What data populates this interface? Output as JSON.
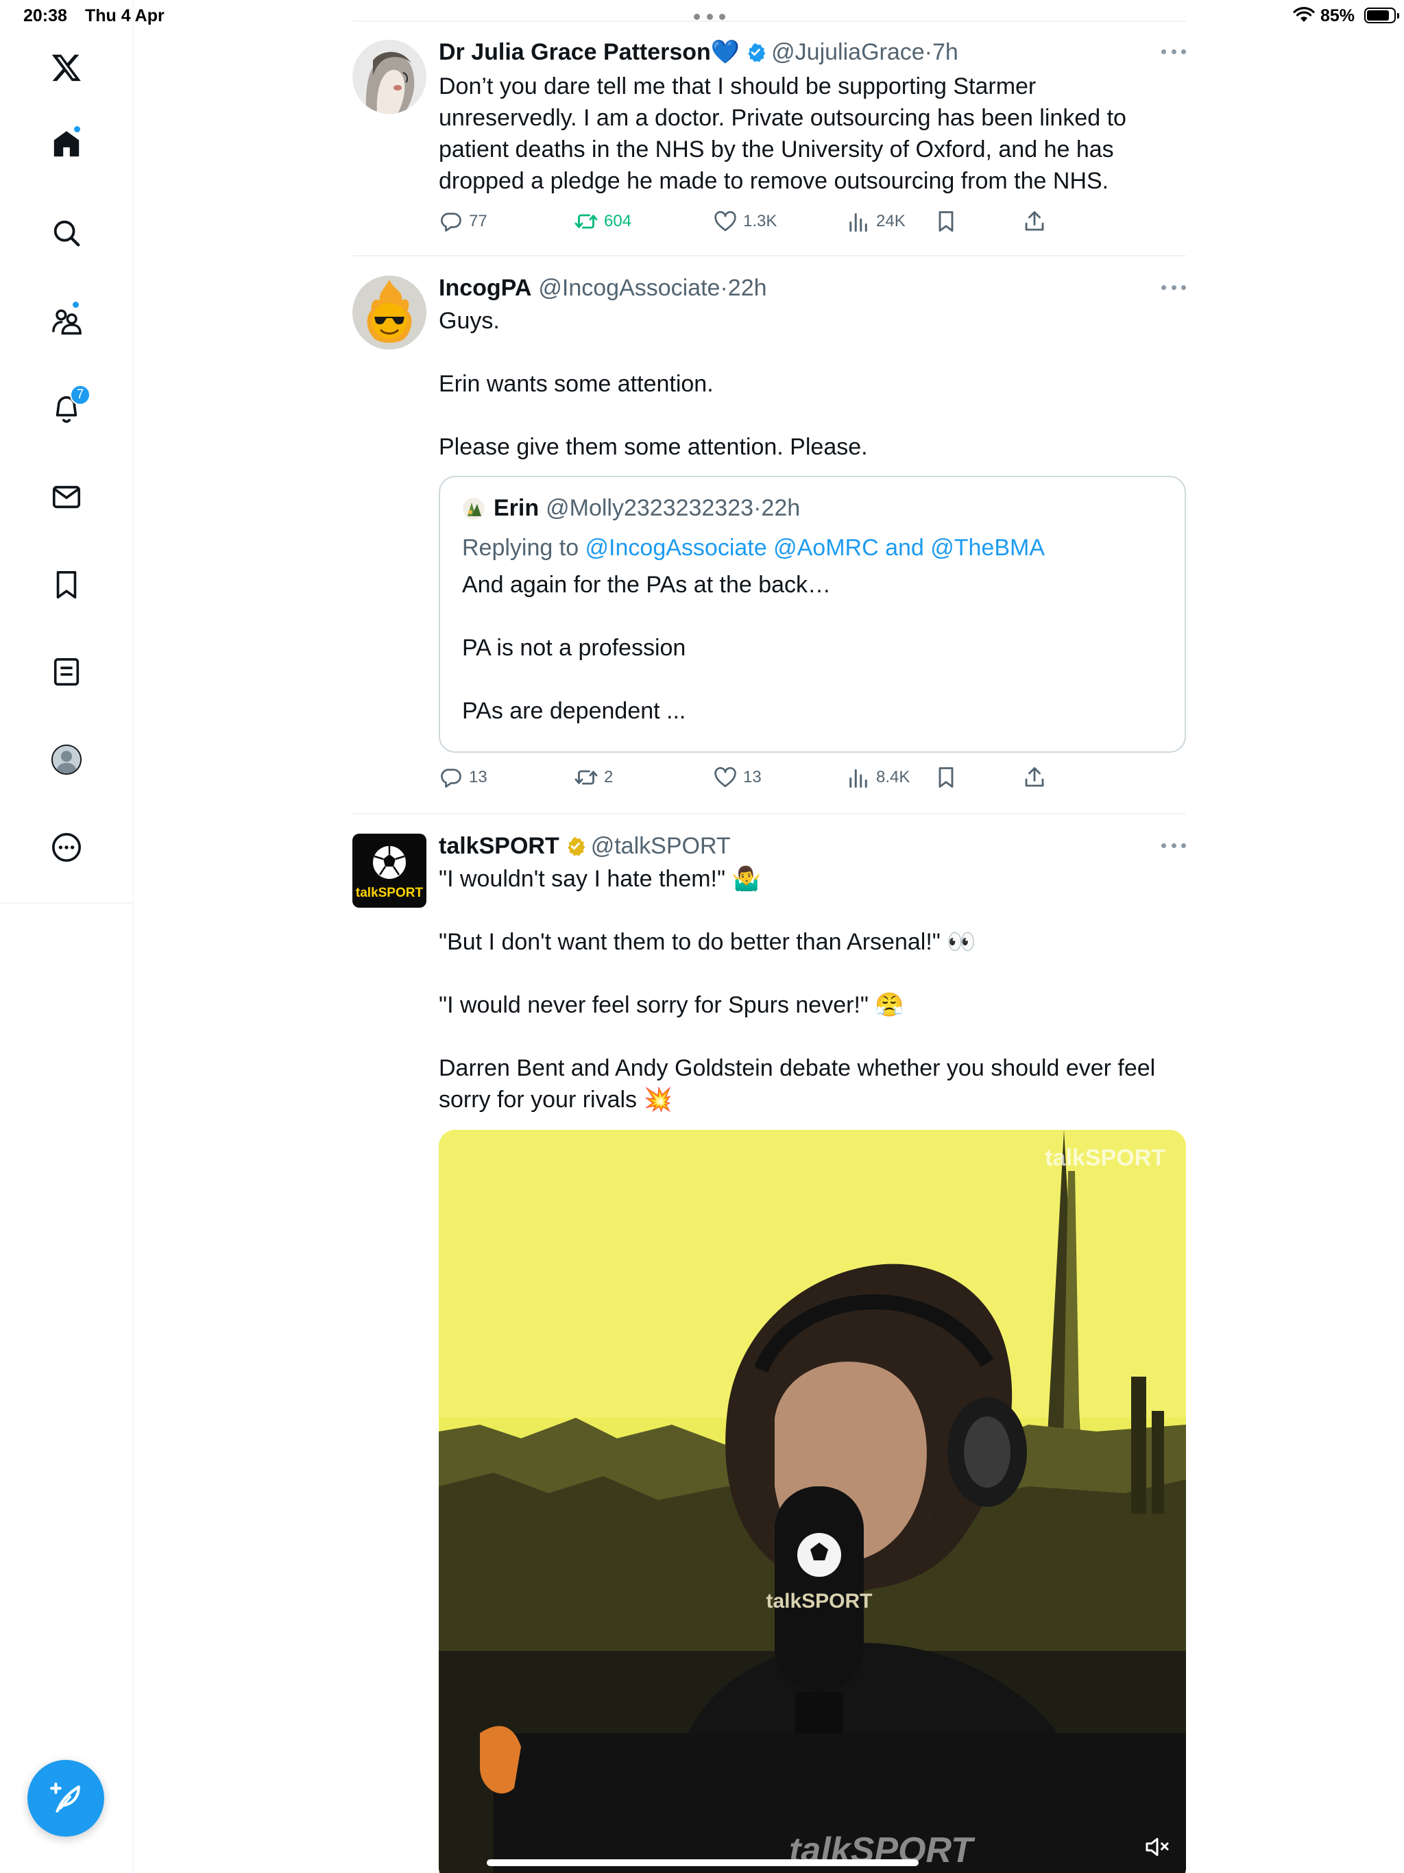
{
  "status_bar": {
    "time": "20:38",
    "date": "Thu 4 Apr",
    "battery": "85%"
  },
  "sidebar": {
    "items": [
      {
        "name": "x-logo"
      },
      {
        "name": "home",
        "has_dot": true
      },
      {
        "name": "search"
      },
      {
        "name": "communities",
        "has_dot": true
      },
      {
        "name": "notifications",
        "badge": "7"
      },
      {
        "name": "messages"
      },
      {
        "name": "bookmarks"
      },
      {
        "name": "lists"
      },
      {
        "name": "profile"
      },
      {
        "name": "more"
      }
    ],
    "accent": "#1d9bf0"
  },
  "tweets": [
    {
      "name": "Dr Julia Grace Patterson💙",
      "verified": true,
      "handle": "@JujuliaGrace",
      "dot": "·",
      "time": "7h",
      "text": [
        "Don’t you dare tell me that I should be supporting Starmer unreservedly. I am a doctor. Private outsourcing has been linked to patient deaths in the NHS by the University of Oxford, and he has dropped a pledge he made to remove outsourcing from the NHS."
      ],
      "replies": "77",
      "reposts": "604",
      "likes": "1.3K",
      "views": "24K"
    },
    {
      "name": "IncogPA",
      "handle": "@IncogAssociate",
      "dot": "·",
      "time": "22h",
      "text": [
        "Guys.",
        "",
        "Erin wants some attention.",
        "",
        "Please give them some attention. Please."
      ],
      "quote": {
        "name": "Erin",
        "handle": "@Molly2323232323",
        "dot": "·",
        "time": "22h",
        "replying_prefix": "Replying to ",
        "replying_links": "@IncogAssociate @AoMRC and @TheBMA",
        "text": [
          "And again for the PAs at the back…",
          "",
          "PA is not a profession",
          "",
          "PAs are dependent ..."
        ]
      },
      "replies": "13",
      "reposts": "2",
      "likes": "13",
      "views": "8.4K"
    },
    {
      "name": "talkSPORT",
      "verified": true,
      "handle": "@talkSPORT",
      "avatar_label": "talkSPORT",
      "text": [
        "\"I wouldn't say I hate them!\" 🤷‍♂️",
        "",
        "\"But I don't want them to do better than Arsenal!\" 👀",
        "",
        "\"I would never feel sorry for Spurs never!\" 😤",
        "",
        "Darren Bent and Andy Goldstein debate whether you should ever feel sorry for your rivals 💥"
      ],
      "media": {
        "watermark": "talkSPORT",
        "mic_label": "talkSPORT",
        "desk_label": "talkSPORT"
      }
    }
  ]
}
